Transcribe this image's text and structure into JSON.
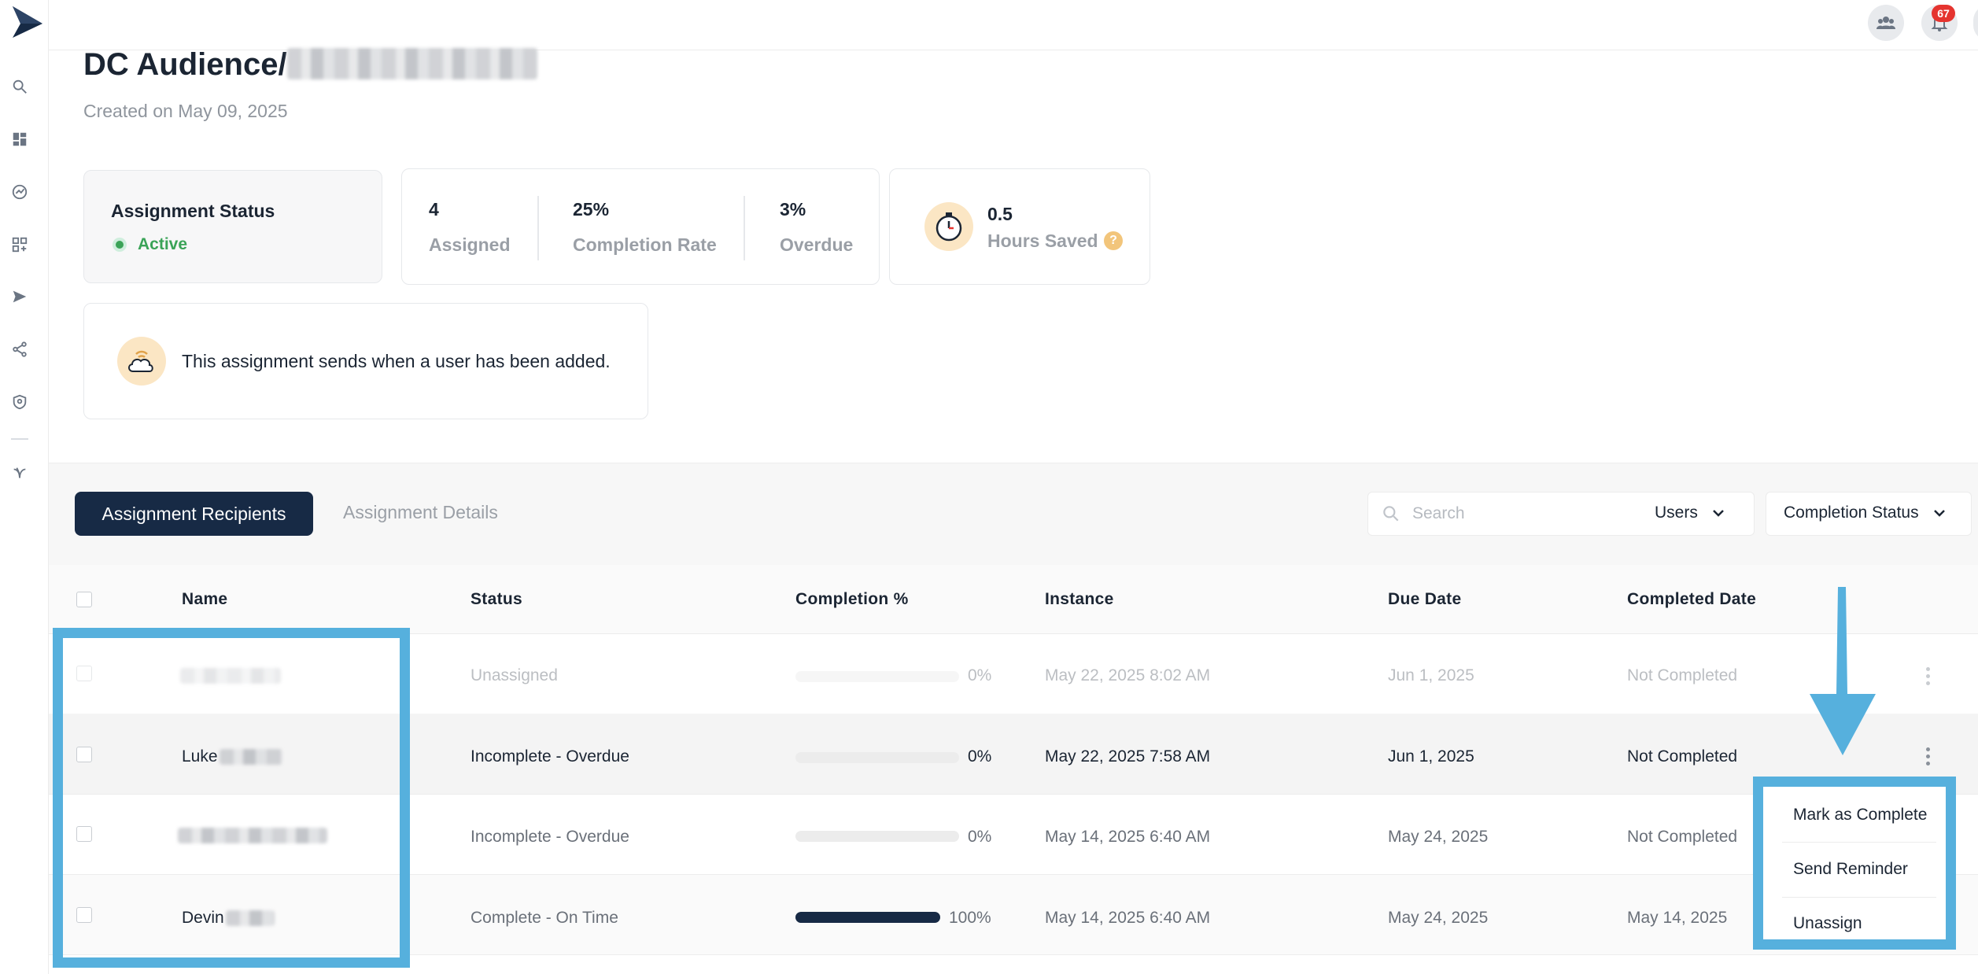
{
  "header": {
    "title": "DC Audience/",
    "created_on": "Created on May 09, 2025"
  },
  "topbar": {
    "notification_count": "67",
    "icons": [
      "logo-icon",
      "team-icon",
      "bell-icon"
    ]
  },
  "sidebar": {
    "icons": [
      "search-icon",
      "dashboard-icon",
      "analytics-icon",
      "apps-icon",
      "send-icon",
      "share-icon",
      "shield-icon",
      "leaf-icon"
    ]
  },
  "status_card": {
    "title": "Assignment Status",
    "status": "Active",
    "status_color": "#3aa357"
  },
  "stats": {
    "assigned_value": "4",
    "assigned_label": "Assigned",
    "completion_value": "25%",
    "completion_label": "Completion Rate",
    "overdue_value": "3%",
    "overdue_label": "Overdue"
  },
  "hours_card": {
    "value": "0.5",
    "label": "Hours Saved",
    "help": "?"
  },
  "trigger_card": {
    "text": "This assignment sends when a user has been added."
  },
  "tabs": {
    "recipients": "Assignment Recipients",
    "details": "Assignment Details"
  },
  "filters": {
    "search_placeholder": "Search",
    "users_dropdown": "Users",
    "status_dropdown": "Completion Status"
  },
  "table": {
    "columns": [
      "Name",
      "Status",
      "Completion %",
      "Instance",
      "Due Date",
      "Completed Date"
    ],
    "rows": [
      {
        "name": "",
        "status": "Unassigned",
        "completion_pct": "0%",
        "completion": 0,
        "instance": "May 22, 2025 8:02 AM",
        "due": "Jun 1, 2025",
        "completed": "Not Completed"
      },
      {
        "name": "Luke",
        "status": "Incomplete - Overdue",
        "completion_pct": "0%",
        "completion": 0,
        "instance": "May 22, 2025 7:58 AM",
        "due": "Jun 1, 2025",
        "completed": "Not Completed"
      },
      {
        "name": "",
        "status": "Incomplete - Overdue",
        "completion_pct": "0%",
        "completion": 0,
        "instance": "May 14, 2025 6:40 AM",
        "due": "May 24, 2025",
        "completed": "Not Completed"
      },
      {
        "name": "Devin",
        "status": "Complete - On Time",
        "completion_pct": "100%",
        "completion": 1,
        "instance": "May 14, 2025 6:40 AM",
        "due": "May 24, 2025",
        "completed": "May 14, 2025"
      }
    ]
  },
  "row_menu": {
    "mark_complete": "Mark as Complete",
    "send_reminder": "Send Reminder",
    "unassign": "Unassign"
  },
  "colors": {
    "accent_navy": "#172a45",
    "annotation_blue": "#56b0dd",
    "notification_red": "#e5342f"
  }
}
